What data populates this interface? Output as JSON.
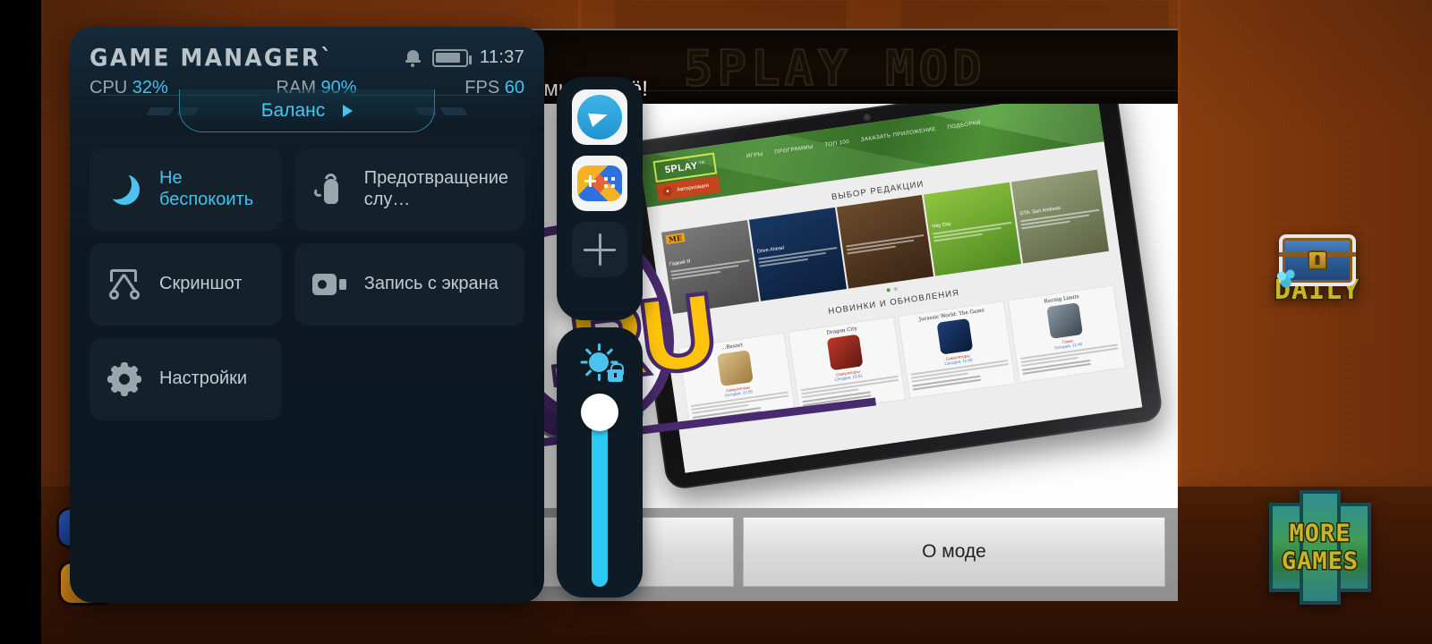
{
  "game_manager": {
    "logo": "GAME MANAGER`",
    "status": {
      "bell_icon": "bell-icon",
      "battery_icon": "battery-icon",
      "time": "11:37"
    },
    "stats": [
      {
        "label": "CPU",
        "value": "32%"
      },
      {
        "label": "RAM",
        "value": "90%"
      },
      {
        "label": "FPS",
        "value": "60"
      }
    ],
    "mode": {
      "label": "Баланс",
      "arrow": "▶"
    },
    "tiles": [
      {
        "icon": "moon-icon",
        "label": "Не беспокоить",
        "active": true
      },
      {
        "icon": "touch-icon",
        "label": "Предотвращение слу…",
        "active": false
      },
      {
        "icon": "scissors-icon",
        "label": "Скриншот",
        "active": false
      },
      {
        "icon": "video-camera-icon",
        "label": "Запись с экрана",
        "active": false
      },
      {
        "icon": "gear-icon",
        "label": "Настройки",
        "active": false
      }
    ],
    "accent_color": "#3fc3f0",
    "panel_color": "#0d1822"
  },
  "dock_apps": {
    "items": [
      {
        "icon": "telegram-icon",
        "name": "Telegram"
      },
      {
        "icon": "google-play-games-icon",
        "name": "Play Games"
      },
      {
        "icon": "plus-icon",
        "name": "Добавить"
      }
    ]
  },
  "brightness_dock": {
    "icon": "brightness-lock-icon",
    "value_percent": 84,
    "slider_color": "#2ec8f5"
  },
  "background": {
    "banner_text": "ажми на неё!",
    "banner_glyphs": "5PLAY  MOD",
    "toolbar": {
      "left_button": "",
      "about_button": "О моде"
    },
    "badges": [
      {
        "name": "daily-chest-badge",
        "label": "DAILY"
      },
      {
        "name": "more-games-badge",
        "label_1": "MORE",
        "label_2": "GAMES"
      }
    ],
    "overlay_text": ".RU"
  },
  "site": {
    "logo": "5PLAY",
    "logo_tld": ".ru",
    "nav": [
      "ИГРЫ",
      "ПРОГРАММЫ",
      "ТОП 100",
      "ЗАКАЗАТЬ ПРИЛОЖЕНИЕ",
      "ПОДБОРКИ"
    ],
    "auth_button": "Авторизация",
    "section_editors": "ВЫБОР РЕДАКЦИИ",
    "section_news": "НОВИНКИ И ОБНОВЛЕНИЯ",
    "editor_cards": [
      {
        "title": "Гадкий Я",
        "badge": "ME"
      },
      {
        "title": "Drive Ahead",
        "badge": ""
      },
      {
        "title": "",
        "badge": ""
      },
      {
        "title": "Hay Day",
        "badge": ""
      },
      {
        "title": "GTA: San Andreas",
        "badge": ""
      }
    ],
    "news_cards": [
      {
        "title": "…Resort",
        "category": "Симуляторы",
        "date": "Сегодня, 11:55"
      },
      {
        "title": "Dragon City",
        "category": "Симуляторы",
        "date": "Сегодня, 10:51"
      },
      {
        "title": "Jurassic World: The Game",
        "category": "Симуляторы",
        "date": "Сегодня, 11:50"
      },
      {
        "title": "Racing Limits",
        "category": "Гонки",
        "date": "Сегодня, 11:40"
      }
    ]
  }
}
